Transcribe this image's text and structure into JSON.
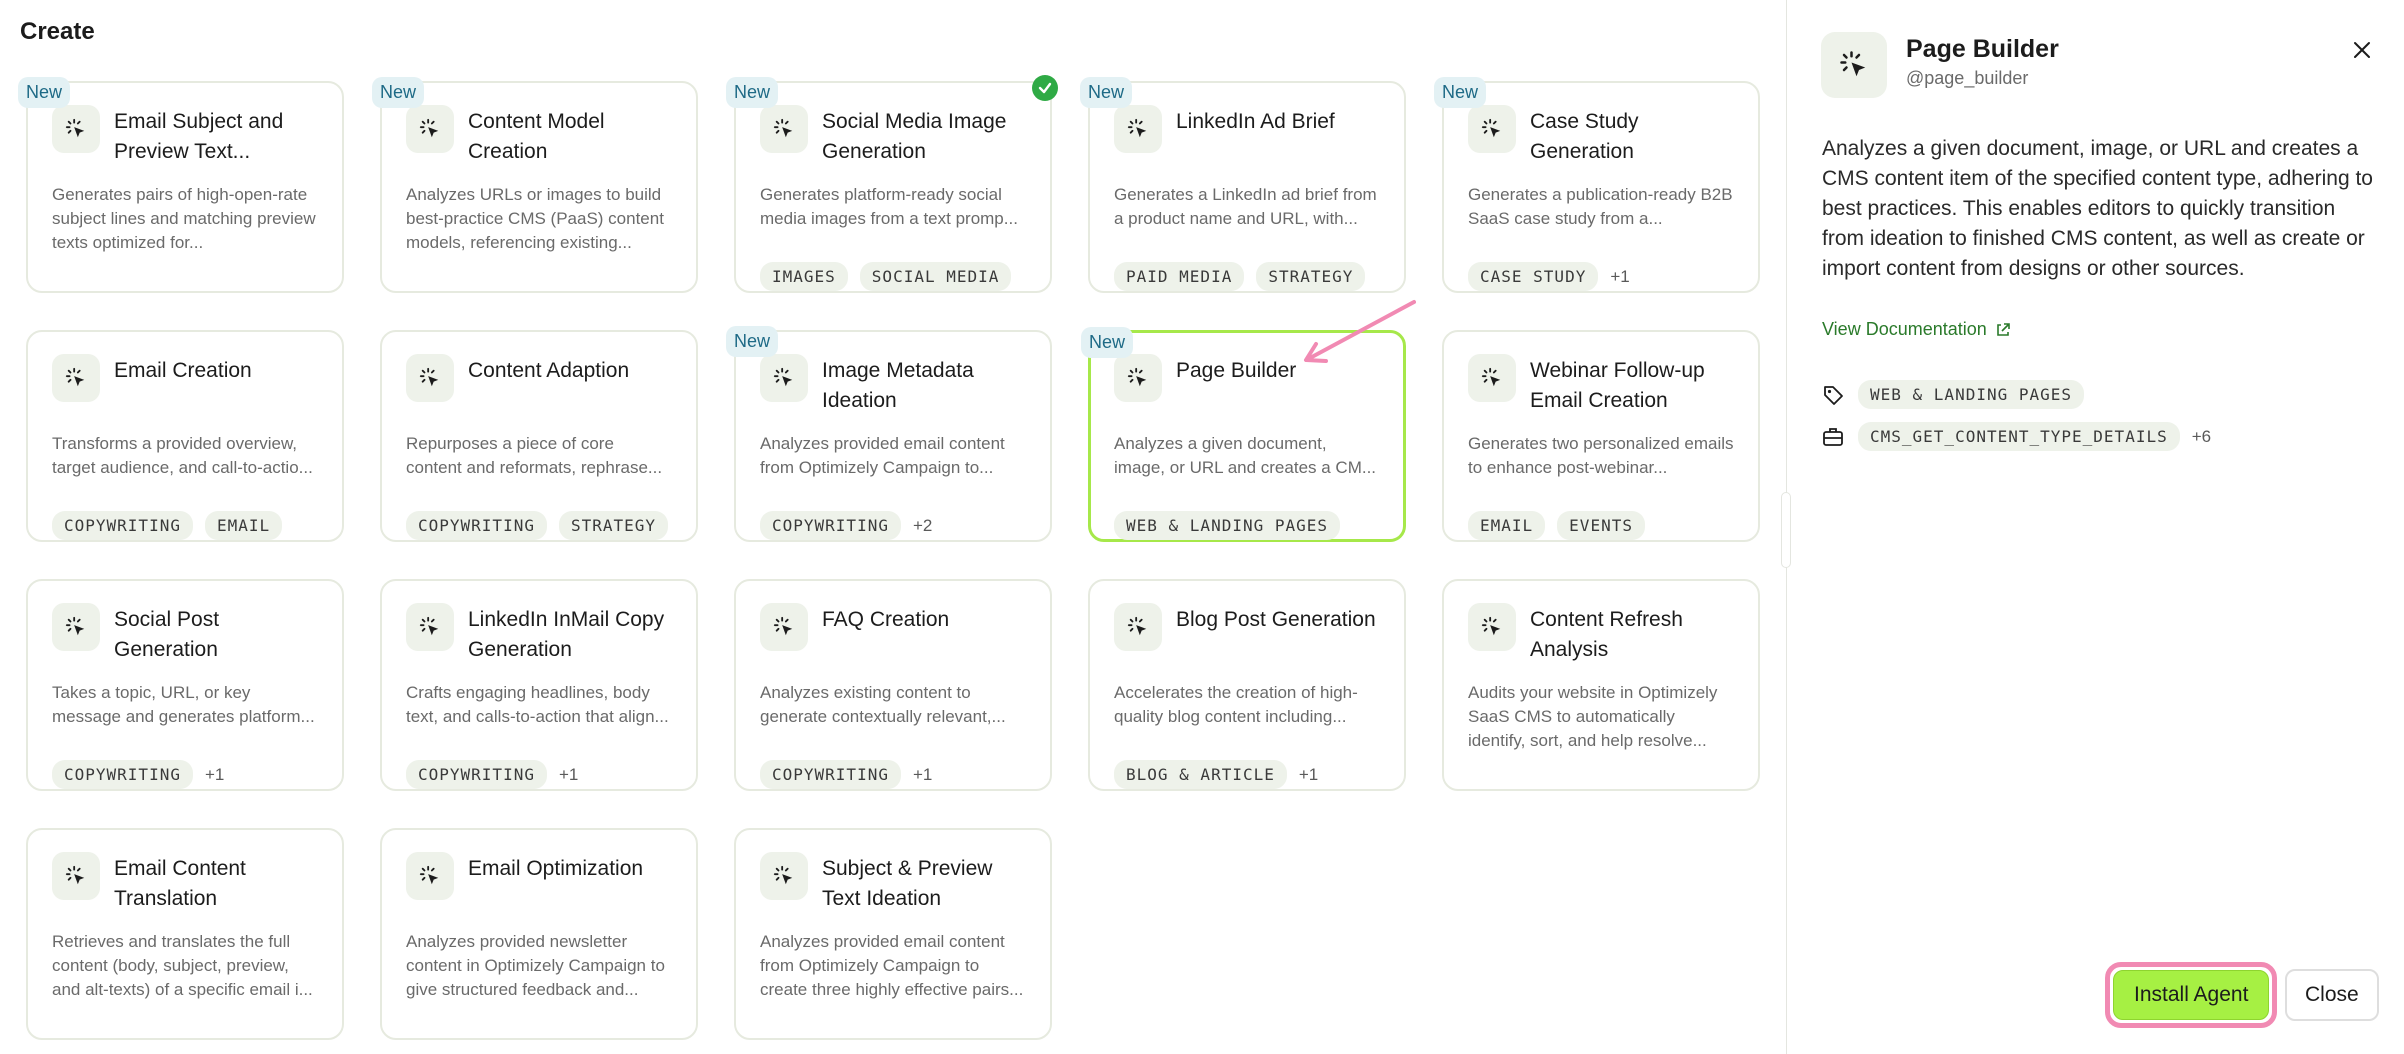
{
  "page": {
    "title": "Create"
  },
  "badges": {
    "new": "New"
  },
  "agents": [
    {
      "title": "Email Subject and Preview Text...",
      "desc": "Generates pairs of high-open-rate subject lines and matching preview texts optimized for...",
      "tags": [],
      "more": "",
      "is_new": true,
      "installed": false,
      "selected": false
    },
    {
      "title": "Content Model Creation",
      "desc": "Analyzes URLs or images to build best-practice CMS (PaaS) content models, referencing existing...",
      "tags": [],
      "more": "",
      "is_new": true,
      "installed": false,
      "selected": false
    },
    {
      "title": "Social Media Image Generation",
      "desc": "Generates platform-ready social media images from a text promp...",
      "tags": [
        "IMAGES",
        "SOCIAL MEDIA"
      ],
      "more": "",
      "is_new": true,
      "installed": true,
      "selected": false
    },
    {
      "title": "LinkedIn Ad Brief",
      "desc": "Generates a LinkedIn ad brief from a product name and URL, with...",
      "tags": [
        "PAID MEDIA",
        "STRATEGY"
      ],
      "more": "",
      "is_new": true,
      "installed": false,
      "selected": false
    },
    {
      "title": "Case Study Generation",
      "desc": "Generates a publication-ready B2B SaaS case study from a...",
      "tags": [
        "CASE STUDY"
      ],
      "more": "+1",
      "is_new": true,
      "installed": false,
      "selected": false
    },
    {
      "title": "Email Creation",
      "desc": "Transforms a provided overview, target audience, and call-to-actio...",
      "tags": [
        "COPYWRITING",
        "EMAIL"
      ],
      "more": "",
      "is_new": false,
      "installed": false,
      "selected": false
    },
    {
      "title": "Content Adaption",
      "desc": "Repurposes a piece of core content and reformats, rephrase...",
      "tags": [
        "COPYWRITING",
        "STRATEGY"
      ],
      "more": "",
      "is_new": false,
      "installed": false,
      "selected": false
    },
    {
      "title": "Image Metadata Ideation",
      "desc": "Analyzes provided email content from Optimizely Campaign to...",
      "tags": [
        "COPYWRITING"
      ],
      "more": "+2",
      "is_new": true,
      "installed": false,
      "selected": false
    },
    {
      "title": "Page Builder",
      "desc": "Analyzes a given document, image, or URL and creates a CM...",
      "tags": [
        "WEB & LANDING PAGES"
      ],
      "more": "",
      "is_new": true,
      "installed": false,
      "selected": true
    },
    {
      "title": "Webinar Follow-up Email Creation",
      "desc": "Generates two personalized emails to enhance post-webinar...",
      "tags": [
        "EMAIL",
        "EVENTS"
      ],
      "more": "",
      "is_new": false,
      "installed": false,
      "selected": false
    },
    {
      "title": "Social Post Generation",
      "desc": "Takes a topic, URL, or key message and generates platform...",
      "tags": [
        "COPYWRITING"
      ],
      "more": "+1",
      "is_new": false,
      "installed": false,
      "selected": false
    },
    {
      "title": "LinkedIn InMail Copy Generation",
      "desc": "Crafts engaging headlines, body text, and calls-to-action that align...",
      "tags": [
        "COPYWRITING"
      ],
      "more": "+1",
      "is_new": false,
      "installed": false,
      "selected": false
    },
    {
      "title": "FAQ Creation",
      "desc": "Analyzes existing content to generate contextually relevant,...",
      "tags": [
        "COPYWRITING"
      ],
      "more": "+1",
      "is_new": false,
      "installed": false,
      "selected": false
    },
    {
      "title": "Blog Post Generation",
      "desc": "Accelerates the creation of high-quality blog content including...",
      "tags": [
        "BLOG & ARTICLE"
      ],
      "more": "+1",
      "is_new": false,
      "installed": false,
      "selected": false
    },
    {
      "title": "Content Refresh Analysis",
      "desc": "Audits your website in Optimizely SaaS CMS to automatically identify, sort, and help resolve...",
      "tags": [],
      "more": "",
      "is_new": false,
      "installed": false,
      "selected": false
    },
    {
      "title": "Email Content Translation",
      "desc": "Retrieves and translates the full content (body, subject, preview, and alt-texts) of a specific email i...",
      "tags": [],
      "more": "",
      "is_new": false,
      "installed": false,
      "selected": false
    },
    {
      "title": "Email Optimization",
      "desc": "Analyzes provided newsletter content in Optimizely Campaign to give structured feedback and...",
      "tags": [],
      "more": "",
      "is_new": false,
      "installed": false,
      "selected": false
    },
    {
      "title": "Subject & Preview Text Ideation",
      "desc": "Analyzes provided email content from Optimizely Campaign to create three highly effective pairs...",
      "tags": [],
      "more": "",
      "is_new": false,
      "installed": false,
      "selected": false
    }
  ],
  "detail": {
    "title": "Page Builder",
    "handle": "@page_builder",
    "description": "Analyzes a given document, image, or URL and creates a CMS content item of the specified content type, adhering to best practices. This enables editors to quickly transition from ideation to finished CMS content, as well as create or import content from designs or other sources.",
    "doc_link": "View Documentation",
    "category_tag": "WEB & LANDING PAGES",
    "tool_tag": "CMS_GET_CONTENT_TYPE_DETAILS",
    "tool_more": "+6",
    "install_label": "Install Agent",
    "close_label": "Close"
  },
  "icons": {
    "agent": "agent-spark-icon",
    "close": "close-icon",
    "external": "external-link-icon",
    "tag": "tag-icon",
    "tools": "toolbox-icon",
    "check": "check-icon"
  },
  "colors": {
    "accent": "#a6f043",
    "selected_border": "#a6e84a",
    "new_badge_bg": "#e3f1f4",
    "new_badge_text": "#1e6a86",
    "check": "#2faa45",
    "link": "#2a7a2a",
    "annotation": "#f18ab3"
  }
}
